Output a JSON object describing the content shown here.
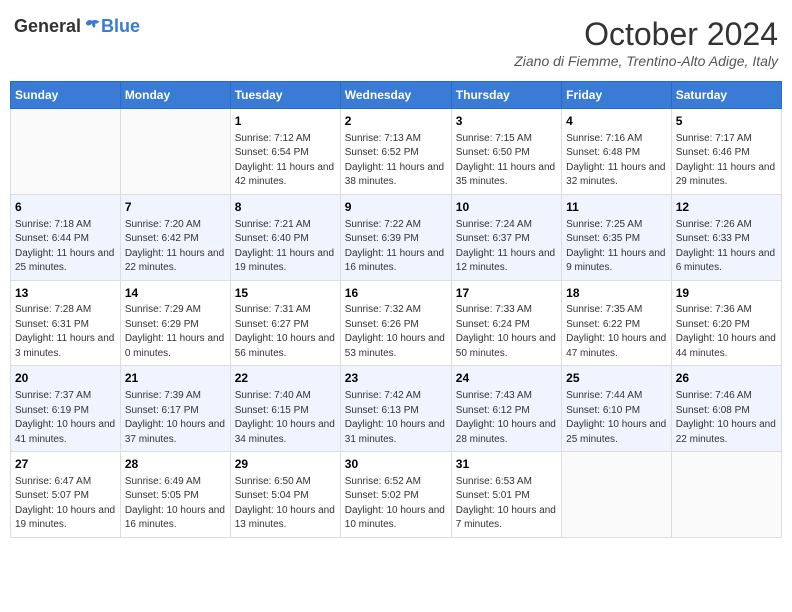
{
  "header": {
    "logo_general": "General",
    "logo_blue": "Blue",
    "month_title": "October 2024",
    "location": "Ziano di Fiemme, Trentino-Alto Adige, Italy"
  },
  "days_of_week": [
    "Sunday",
    "Monday",
    "Tuesday",
    "Wednesday",
    "Thursday",
    "Friday",
    "Saturday"
  ],
  "weeks": [
    [
      {
        "day": "",
        "info": ""
      },
      {
        "day": "",
        "info": ""
      },
      {
        "day": "1",
        "info": "Sunrise: 7:12 AM\nSunset: 6:54 PM\nDaylight: 11 hours and 42 minutes."
      },
      {
        "day": "2",
        "info": "Sunrise: 7:13 AM\nSunset: 6:52 PM\nDaylight: 11 hours and 38 minutes."
      },
      {
        "day": "3",
        "info": "Sunrise: 7:15 AM\nSunset: 6:50 PM\nDaylight: 11 hours and 35 minutes."
      },
      {
        "day": "4",
        "info": "Sunrise: 7:16 AM\nSunset: 6:48 PM\nDaylight: 11 hours and 32 minutes."
      },
      {
        "day": "5",
        "info": "Sunrise: 7:17 AM\nSunset: 6:46 PM\nDaylight: 11 hours and 29 minutes."
      }
    ],
    [
      {
        "day": "6",
        "info": "Sunrise: 7:18 AM\nSunset: 6:44 PM\nDaylight: 11 hours and 25 minutes."
      },
      {
        "day": "7",
        "info": "Sunrise: 7:20 AM\nSunset: 6:42 PM\nDaylight: 11 hours and 22 minutes."
      },
      {
        "day": "8",
        "info": "Sunrise: 7:21 AM\nSunset: 6:40 PM\nDaylight: 11 hours and 19 minutes."
      },
      {
        "day": "9",
        "info": "Sunrise: 7:22 AM\nSunset: 6:39 PM\nDaylight: 11 hours and 16 minutes."
      },
      {
        "day": "10",
        "info": "Sunrise: 7:24 AM\nSunset: 6:37 PM\nDaylight: 11 hours and 12 minutes."
      },
      {
        "day": "11",
        "info": "Sunrise: 7:25 AM\nSunset: 6:35 PM\nDaylight: 11 hours and 9 minutes."
      },
      {
        "day": "12",
        "info": "Sunrise: 7:26 AM\nSunset: 6:33 PM\nDaylight: 11 hours and 6 minutes."
      }
    ],
    [
      {
        "day": "13",
        "info": "Sunrise: 7:28 AM\nSunset: 6:31 PM\nDaylight: 11 hours and 3 minutes."
      },
      {
        "day": "14",
        "info": "Sunrise: 7:29 AM\nSunset: 6:29 PM\nDaylight: 11 hours and 0 minutes."
      },
      {
        "day": "15",
        "info": "Sunrise: 7:31 AM\nSunset: 6:27 PM\nDaylight: 10 hours and 56 minutes."
      },
      {
        "day": "16",
        "info": "Sunrise: 7:32 AM\nSunset: 6:26 PM\nDaylight: 10 hours and 53 minutes."
      },
      {
        "day": "17",
        "info": "Sunrise: 7:33 AM\nSunset: 6:24 PM\nDaylight: 10 hours and 50 minutes."
      },
      {
        "day": "18",
        "info": "Sunrise: 7:35 AM\nSunset: 6:22 PM\nDaylight: 10 hours and 47 minutes."
      },
      {
        "day": "19",
        "info": "Sunrise: 7:36 AM\nSunset: 6:20 PM\nDaylight: 10 hours and 44 minutes."
      }
    ],
    [
      {
        "day": "20",
        "info": "Sunrise: 7:37 AM\nSunset: 6:19 PM\nDaylight: 10 hours and 41 minutes."
      },
      {
        "day": "21",
        "info": "Sunrise: 7:39 AM\nSunset: 6:17 PM\nDaylight: 10 hours and 37 minutes."
      },
      {
        "day": "22",
        "info": "Sunrise: 7:40 AM\nSunset: 6:15 PM\nDaylight: 10 hours and 34 minutes."
      },
      {
        "day": "23",
        "info": "Sunrise: 7:42 AM\nSunset: 6:13 PM\nDaylight: 10 hours and 31 minutes."
      },
      {
        "day": "24",
        "info": "Sunrise: 7:43 AM\nSunset: 6:12 PM\nDaylight: 10 hours and 28 minutes."
      },
      {
        "day": "25",
        "info": "Sunrise: 7:44 AM\nSunset: 6:10 PM\nDaylight: 10 hours and 25 minutes."
      },
      {
        "day": "26",
        "info": "Sunrise: 7:46 AM\nSunset: 6:08 PM\nDaylight: 10 hours and 22 minutes."
      }
    ],
    [
      {
        "day": "27",
        "info": "Sunrise: 6:47 AM\nSunset: 5:07 PM\nDaylight: 10 hours and 19 minutes."
      },
      {
        "day": "28",
        "info": "Sunrise: 6:49 AM\nSunset: 5:05 PM\nDaylight: 10 hours and 16 minutes."
      },
      {
        "day": "29",
        "info": "Sunrise: 6:50 AM\nSunset: 5:04 PM\nDaylight: 10 hours and 13 minutes."
      },
      {
        "day": "30",
        "info": "Sunrise: 6:52 AM\nSunset: 5:02 PM\nDaylight: 10 hours and 10 minutes."
      },
      {
        "day": "31",
        "info": "Sunrise: 6:53 AM\nSunset: 5:01 PM\nDaylight: 10 hours and 7 minutes."
      },
      {
        "day": "",
        "info": ""
      },
      {
        "day": "",
        "info": ""
      }
    ]
  ]
}
